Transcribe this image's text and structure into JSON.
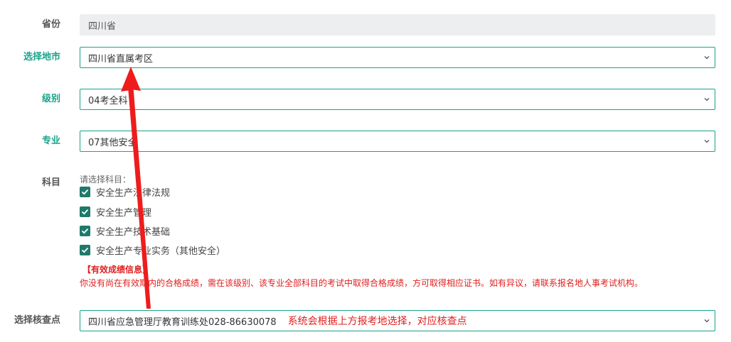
{
  "form": {
    "province": {
      "label": "省份",
      "value": "四川省"
    },
    "city": {
      "label": "选择地市",
      "value": "四川省直属考区"
    },
    "level": {
      "label": "级别",
      "value": "04考全科"
    },
    "major": {
      "label": "专业",
      "value": "07其他安全"
    },
    "subjects": {
      "label": "科目",
      "prompt": "请选择科目：",
      "items": [
        {
          "label": "安全生产法律法规",
          "checked": true
        },
        {
          "label": "安全生产管理",
          "checked": true
        },
        {
          "label": "安全生产技术基础",
          "checked": true
        },
        {
          "label": "安全生产专业实务（其他安全）",
          "checked": true
        }
      ]
    },
    "validity": {
      "title": "【有效成绩信息】",
      "message": "你没有尚在有效期内的合格成绩，需在该级别、该专业全部科目的考试中取得合格成绩，方可取得相应证书。如有异议，请联系报名地人事考试机构。"
    },
    "checkpoint": {
      "label": "选择核查点",
      "value": "四川省应急管理厅教育训练处028-86630078",
      "annotation": "系统会根据上方报考地选择，对应核查点"
    }
  },
  "colors": {
    "accent": "#1aa38a",
    "checkbox": "#1e7a6a",
    "warning": "#e02020",
    "arrow": "#ee1c1c"
  }
}
